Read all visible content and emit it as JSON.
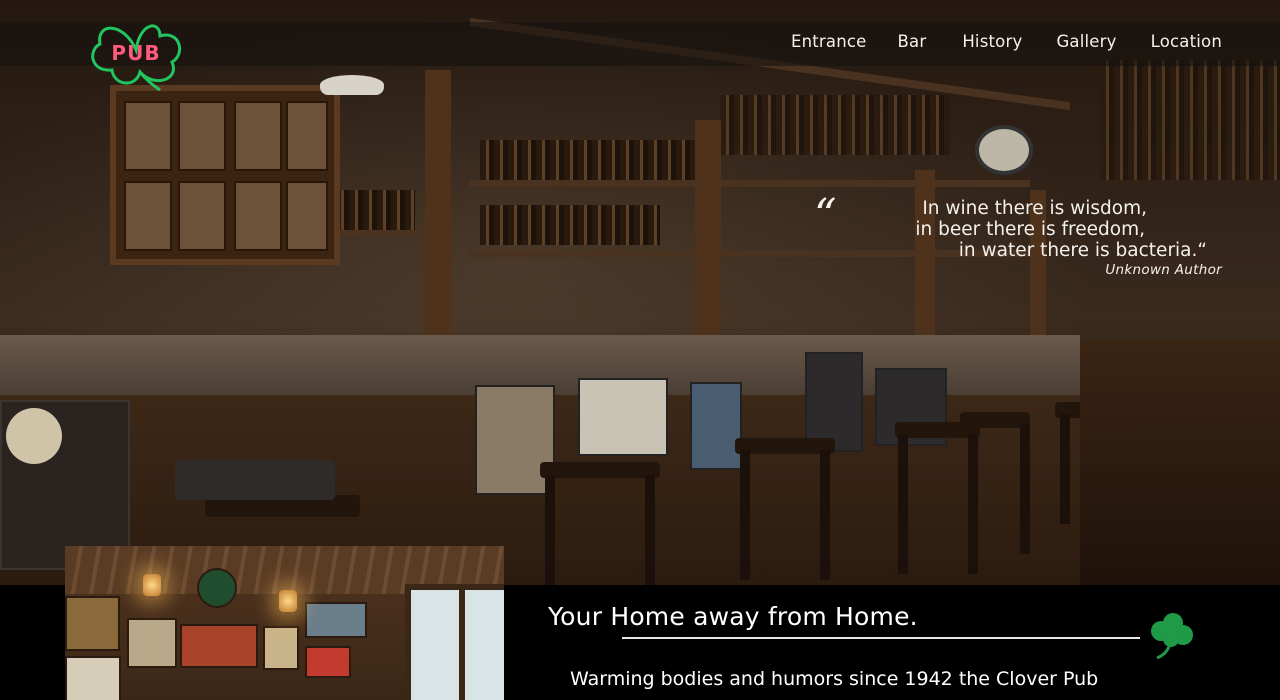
{
  "logo": {
    "text": "PUB",
    "icon": "clover-neon-icon",
    "neon_color": "#22c55e",
    "text_color": "#ff5a7a"
  },
  "nav": {
    "items": [
      {
        "label": "Entrance"
      },
      {
        "label": "Bar"
      },
      {
        "label": "History"
      },
      {
        "label": "Gallery"
      },
      {
        "label": "Location"
      }
    ]
  },
  "quote": {
    "open_mark": "“",
    "lines": [
      "In wine there is wisdom,",
      "in beer there is freedom,",
      "in water there is bacteria.“"
    ],
    "author": "Unknown Author"
  },
  "intro": {
    "headline": "Your Home away from Home.",
    "subline": "Warming bodies and humors since 1942 the Clover Pub",
    "icon": "shamrock-icon",
    "accent_color": "#1f9a47"
  }
}
